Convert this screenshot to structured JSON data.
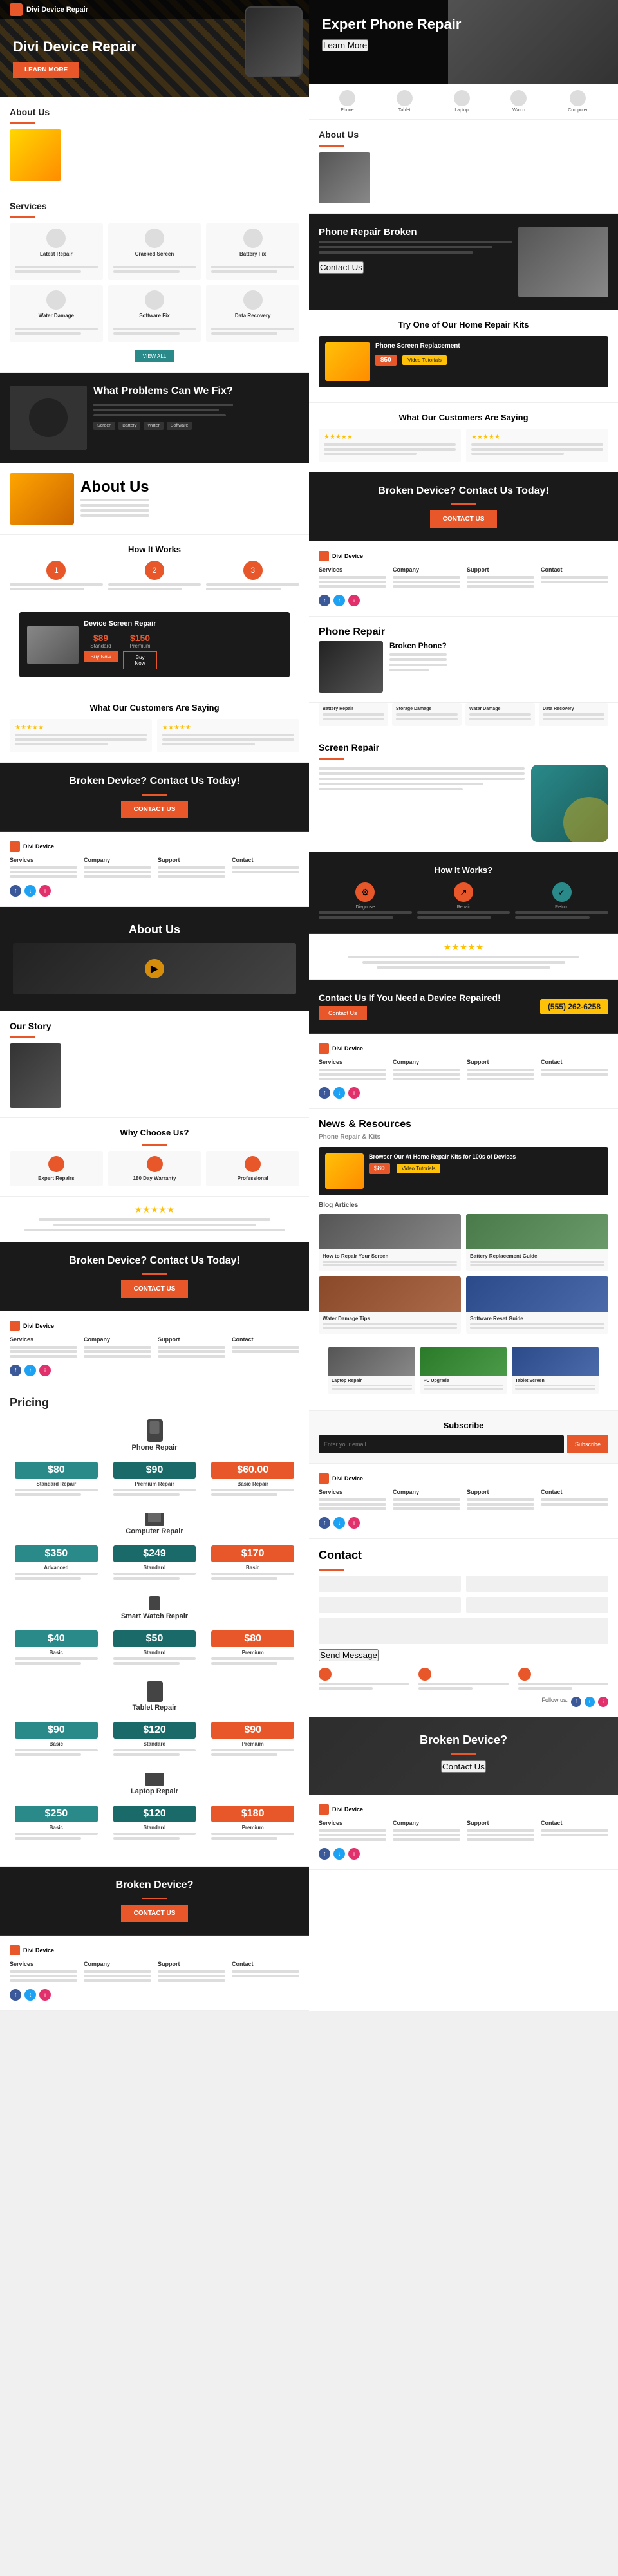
{
  "left": {
    "hero": {
      "title": "Divi Device Repair",
      "btn": "Learn More"
    },
    "about": {
      "heading": "About Us",
      "text_lines": 5
    },
    "services": {
      "heading": "Services",
      "btn": "View All",
      "items": [
        {
          "title": "Latest Repair"
        },
        {
          "title": "Cracked Screen"
        },
        {
          "title": "Battery Fix"
        },
        {
          "title": "Water Damage"
        },
        {
          "title": "Software Fix"
        },
        {
          "title": "Data Recovery"
        }
      ]
    },
    "problems": {
      "heading": "What Problems Can We Fix?"
    },
    "about2": {
      "heading": "About Us"
    },
    "how_it_works": {
      "heading": "How It Works",
      "steps": [
        "1",
        "2",
        "3"
      ]
    },
    "pricing_box": {
      "heading": "Device Screen Repair",
      "price1": "$89",
      "price2": "$150",
      "label1": "Standard",
      "label2": "Premium"
    },
    "testimonials": {
      "heading": "What Our Customers Are Saying"
    },
    "cta1": {
      "heading": "Broken Device? Contact Us Today!",
      "btn": "Contact Us"
    },
    "footer1": {
      "col1": "Services",
      "col2": "Company",
      "col3": "Support",
      "col4": "Contact"
    },
    "about_page": {
      "hero_heading": "About Us",
      "our_story": "Our Story",
      "why_heading": "Why Choose Us?",
      "why_cards": [
        {
          "title": "Expert Repairs"
        },
        {
          "title": "180 Day Warranty"
        },
        {
          "title": "Professional"
        }
      ]
    },
    "cta2": {
      "heading": "Broken Device? Contact Us Today!",
      "btn": "Contact Us"
    },
    "footer2": {
      "col1": "Services",
      "col2": "Company",
      "col3": "Support",
      "col4": "Contact"
    },
    "pricing_page": {
      "heading": "Pricing",
      "phone_repair": {
        "heading": "Phone Repair",
        "tiers": [
          {
            "price": "$80",
            "label": "Standard Repair"
          },
          {
            "price": "$90",
            "label": "Premium Repair"
          },
          {
            "price": "$60.00",
            "label": "Basic Repair"
          }
        ]
      },
      "computer_repair": {
        "heading": "Computer Repair",
        "tiers": [
          {
            "price": "$350",
            "label": "Advanced"
          },
          {
            "price": "$249",
            "label": "Standard"
          },
          {
            "price": "$170",
            "label": "Basic"
          }
        ]
      },
      "smartwatch_repair": {
        "heading": "Smart Watch Repair",
        "tiers": [
          {
            "price": "$40",
            "label": "Basic"
          },
          {
            "price": "$50",
            "label": "Standard"
          },
          {
            "price": "$80",
            "label": "Premium"
          }
        ]
      },
      "tablet_repair": {
        "heading": "Tablet Repair",
        "tiers": [
          {
            "price": "$90",
            "label": "Basic"
          },
          {
            "price": "$120",
            "label": "Standard"
          },
          {
            "price": "$90",
            "label": "Premium"
          }
        ]
      },
      "laptop_repair": {
        "heading": "Laptop Repair",
        "tiers": [
          {
            "price": "$250",
            "label": "Basic"
          },
          {
            "price": "$120",
            "label": "Standard"
          },
          {
            "price": "$180",
            "label": "Premium"
          }
        ]
      }
    },
    "cta3": {
      "heading": "Broken Device?",
      "btn": "Contact Us"
    },
    "footer3": {
      "col1": "Services",
      "col2": "Company",
      "col3": "Support",
      "col4": "Contact"
    }
  },
  "right": {
    "hero": {
      "title": "Expert Phone Repair",
      "btn": "Learn More"
    },
    "about": {
      "heading": "About Us"
    },
    "phone_broken": {
      "heading": "Phone Repair Broken"
    },
    "kits": {
      "heading": "Try One of Our Home Repair Kits",
      "kit_title": "Phone Screen Replacement",
      "price": "$50",
      "video_btn": "Video Tutorials"
    },
    "customers": {
      "heading": "What Our Customers Are Saying"
    },
    "cta1": {
      "heading": "Broken Device? Contact Us Today!",
      "btn": "Contact Us"
    },
    "footer1": {
      "col1": "Services",
      "col2": "Company",
      "col3": "Support",
      "col4": "Contact"
    },
    "phone_repair": {
      "heading": "Phone Repair",
      "broken_heading": "Broken Phone?"
    },
    "screen_repair": {
      "heading": "Screen Repair"
    },
    "how_right": {
      "heading": "How It Works?"
    },
    "rating": {
      "stars": "★★★★★"
    },
    "contact_cta": {
      "heading": "Contact Us If You Need a Device Repaired!",
      "phone": "(555) 262-6258",
      "btn": "Contact Us"
    },
    "footer2": {
      "col1": "Services",
      "col2": "Company",
      "col3": "Support",
      "col4": "Contact"
    },
    "news": {
      "heading": "News & Resources",
      "sub": "Phone Repair & Kits",
      "kit_title": "Browser Our At Home Repair Kits for 100s of Devices",
      "price": "$80",
      "video_btn": "Video Tutorials",
      "blog_label": "Blog Articles",
      "subscribe_heading": "Subscribe",
      "subscribe_placeholder": "Enter your email...",
      "subscribe_btn": "Subscribe"
    },
    "contact_page": {
      "heading": "Contact"
    },
    "broken_device": {
      "heading": "Broken Device?"
    },
    "footer3": {
      "col1": "Services",
      "col2": "Company",
      "col3": "Support",
      "col4": "Contact"
    }
  }
}
